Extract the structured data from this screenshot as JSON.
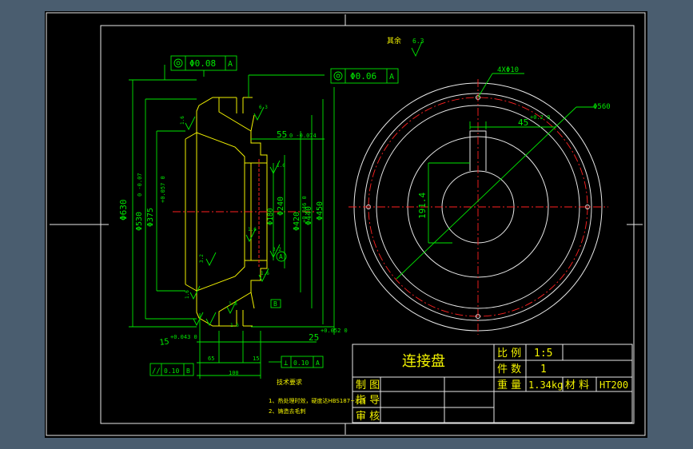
{
  "title_block": {
    "part_name": "连接盘",
    "scale_label": "比 例",
    "scale_value": "1:5",
    "count_label": "件 数",
    "count_value": "1",
    "weight_label": "重 量",
    "weight_value": "1.34kg",
    "material_label": "材 料",
    "material_value": "HT200",
    "drawn_label": "制 图",
    "guide_label": "指 导",
    "review_label": "审 核"
  },
  "surface": {
    "rest_label": "其余",
    "rest_value": "6.3"
  },
  "tolerance_frames": {
    "f1_value": "Φ0.08",
    "f1_datum": "A",
    "f2_value": "Φ0.06",
    "f2_datum": "A",
    "f3_symbol": "//",
    "f3_value": "0.10",
    "f3_datum": "B",
    "f4_symbol": "⊥",
    "f4_value": "0.10",
    "f4_datum": "A"
  },
  "dimensions": {
    "d630": "Φ630",
    "d530": "Φ530",
    "d375": "Φ375",
    "d180": "Φ180",
    "d240": "Φ240",
    "d420": "Φ420",
    "d440": "Φ440",
    "d450": "Φ450",
    "d560": "Φ560",
    "holes": "4XΦ10",
    "key_depth": "191.4",
    "key_width": "45",
    "width_55": "55",
    "width_25": "25",
    "width_15": "15",
    "width_65": "65",
    "width_15b": "15",
    "width_100": "100",
    "tol_d530": "0 -0.07",
    "tol_d375": "+0.057 0",
    "tol_d240": "+0.046 0",
    "tol_55": "0 -0.074",
    "tol_25": "+0.052 0",
    "tol_15": "+0.043 0",
    "tol_45": "+0.2 0",
    "rough_16": "1.6",
    "rough_32": "3.2",
    "rough_63": "6.3",
    "datum_a": "A",
    "datum_b": "B"
  },
  "notes": {
    "heading": "技术要求",
    "line1": "1、热处理时效，硬度达HBS187~229",
    "line2": "2、铸造去毛刺"
  }
}
